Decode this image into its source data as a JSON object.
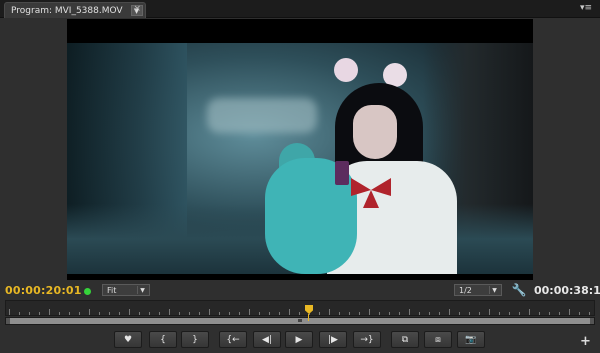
{
  "tab": {
    "label": "Program: MVI_5388.MOV",
    "dropdown_icon": "chevron-down-icon",
    "close_label": "×"
  },
  "panel_menu_label": "▾≡",
  "timecode": {
    "current": "00:00:20:01",
    "duration": "00:00:38:17",
    "current_color": "#e8b824"
  },
  "zoom_select": {
    "value": "Fit"
  },
  "resolution_select": {
    "value": "1/2"
  },
  "colors": {
    "accent": "#e8b824",
    "indicator_green": "#35d33a",
    "panel_bg": "#2f2f2f"
  },
  "transport": {
    "buttons": [
      {
        "name": "add-marker-button",
        "glyph": "♥",
        "icon": "marker-icon"
      },
      {
        "name": "mark-in-button",
        "glyph": "{",
        "icon": "mark-in-icon"
      },
      {
        "name": "mark-out-button",
        "glyph": "}",
        "icon": "mark-out-icon"
      },
      {
        "name": "go-to-in-button",
        "glyph": "{←",
        "icon": "go-to-in-icon"
      },
      {
        "name": "step-back-button",
        "glyph": "◀|",
        "icon": "step-back-icon"
      },
      {
        "name": "play-button",
        "glyph": "▶",
        "icon": "play-icon"
      },
      {
        "name": "step-forward-button",
        "glyph": "|▶",
        "icon": "step-forward-icon"
      },
      {
        "name": "go-to-out-button",
        "glyph": "→}",
        "icon": "go-to-out-icon"
      },
      {
        "name": "lift-button",
        "glyph": "⧉",
        "icon": "lift-icon"
      },
      {
        "name": "extract-button",
        "glyph": "⧈",
        "icon": "extract-icon"
      },
      {
        "name": "export-frame-button",
        "glyph": "📷",
        "icon": "camera-icon"
      }
    ],
    "add_button_label": "+"
  },
  "playhead_position": 0.52
}
